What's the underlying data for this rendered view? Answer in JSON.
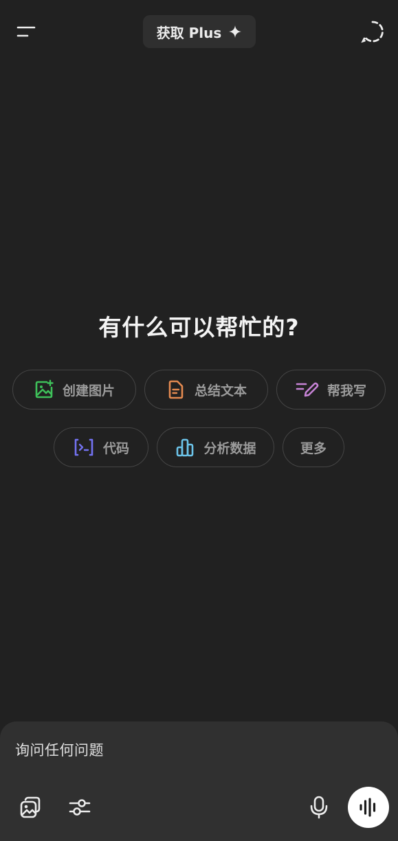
{
  "header": {
    "menu_icon": "menu-icon",
    "upgrade_label": "获取 Plus",
    "upgrade_icon": "sparkle-icon",
    "new_chat_icon": "dashed-chat-icon"
  },
  "main": {
    "heading": "有什么可以帮忙的?",
    "suggestions": [
      {
        "label": "创建图片",
        "icon": "image-create-icon",
        "color": "#3ec15a"
      },
      {
        "label": "总结文本",
        "icon": "document-icon",
        "color": "#e48a50"
      },
      {
        "label": "帮我写",
        "icon": "pen-icon",
        "color": "#c783d6"
      },
      {
        "label": "代码",
        "icon": "code-terminal-icon",
        "color": "#7372f2"
      },
      {
        "label": "分析数据",
        "icon": "bar-chart-icon",
        "color": "#6cc4ea"
      },
      {
        "label": "更多",
        "icon": "",
        "color": ""
      }
    ]
  },
  "composer": {
    "placeholder": "询问任何问题",
    "attach_icon": "image-attach-icon",
    "tools_icon": "sliders-icon",
    "mic_icon": "microphone-icon",
    "voice_icon": "voice-wave-icon"
  },
  "colors": {
    "background": "#212121",
    "composer": "#303030",
    "chip_border": "#454545"
  }
}
